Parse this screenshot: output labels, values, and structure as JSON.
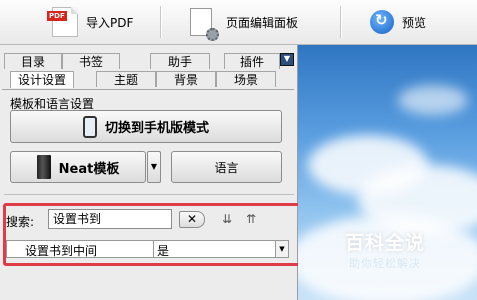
{
  "toolbar": {
    "import_pdf": "导入PDF",
    "page_edit_panel": "页面编辑面板",
    "preview": "预览"
  },
  "tabs_row1": [
    "目录",
    "书签",
    "助手",
    "插件"
  ],
  "tabs_row2": [
    "设计设置",
    "主题",
    "背景",
    "场景"
  ],
  "active_tab": "设计设置",
  "group_label": "模板和语言设置",
  "buttons": {
    "switch_mobile": "切换到手机版模式",
    "template": "Neat模板",
    "language": "语言"
  },
  "search": {
    "label": "搜索:",
    "value": "设置书到"
  },
  "property": {
    "name": "设置书到中间",
    "value": "是"
  },
  "watermark": {
    "title": "百科全说",
    "subtitle": "助你轻松解决"
  },
  "colors": {
    "highlight": "#e03c48",
    "sky": "#5a9ee0"
  }
}
